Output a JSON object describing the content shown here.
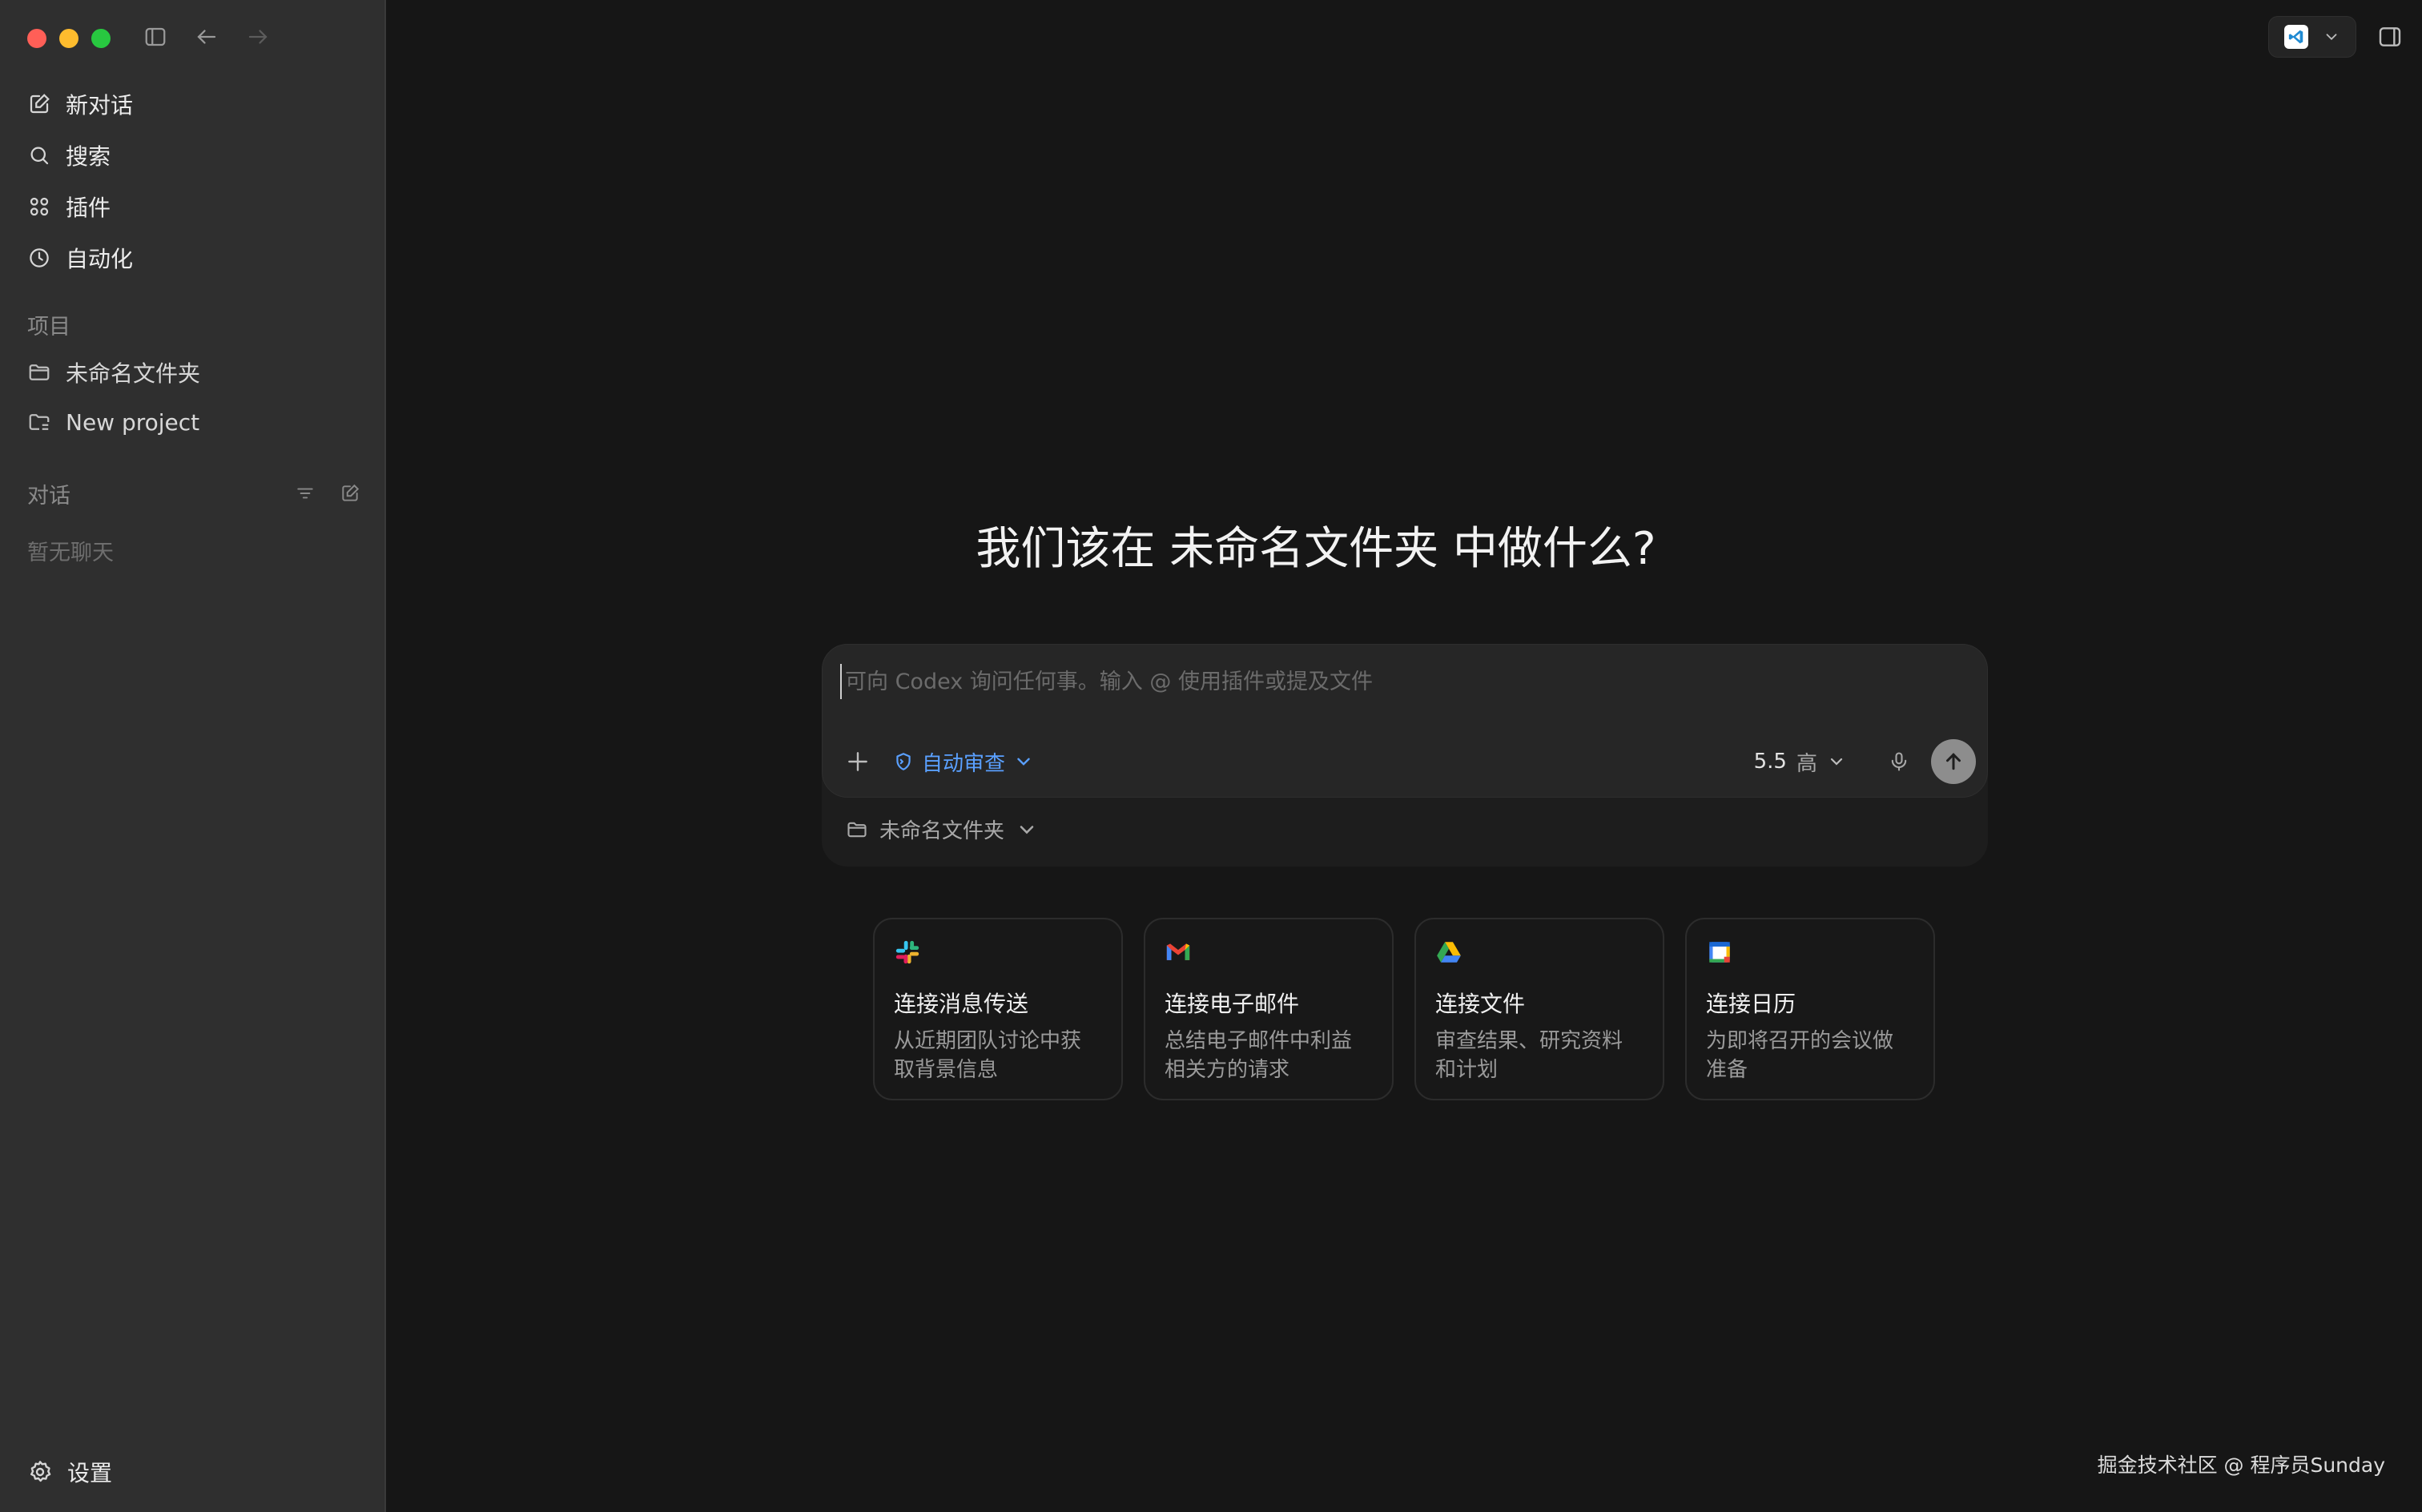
{
  "window": {
    "nav_items": [
      {
        "label": "新对话",
        "icon": "new-chat-icon"
      },
      {
        "label": "搜索",
        "icon": "search-icon"
      },
      {
        "label": "插件",
        "icon": "plugins-icon"
      },
      {
        "label": "自动化",
        "icon": "clock-icon"
      }
    ],
    "projects_title": "项目",
    "projects": [
      {
        "label": "未命名文件夹",
        "icon": "folder-icon"
      },
      {
        "label": "New project",
        "icon": "project-folder-icon"
      }
    ],
    "conversations_title": "对话",
    "conversations_empty": "暂无聊天",
    "settings_label": "设置"
  },
  "main": {
    "heading": "我们该在 未命名文件夹 中做什么?",
    "composer": {
      "placeholder": "可向 Codex 询问任何事。输入 @ 使用插件或提及文件",
      "review_label": "自动审查",
      "model_version": "5.5",
      "model_level": "高",
      "folder_label": "未命名文件夹"
    },
    "cards": [
      {
        "title": "连接消息传送",
        "desc_line1": "从近期团队讨论中获",
        "desc_line2": "取背景信息",
        "icon": "slack-icon"
      },
      {
        "title": "连接电子邮件",
        "desc_line1": "总结电子邮件中利益",
        "desc_line2": "相关方的请求",
        "icon": "gmail-icon"
      },
      {
        "title": "连接文件",
        "desc_line1": "审查结果、研究资料",
        "desc_line2": "和计划",
        "icon": "google-drive-icon"
      },
      {
        "title": "连接日历",
        "desc_line1": "为即将召开的会议做",
        "desc_line2": "准备",
        "icon": "google-calendar-icon"
      }
    ],
    "watermark": "掘金技术社区 @ 程序员Sunday"
  },
  "colors": {
    "accent": "#5aa0ff",
    "sidebar_bg": "#2f2f2f",
    "main_bg": "#161616"
  }
}
